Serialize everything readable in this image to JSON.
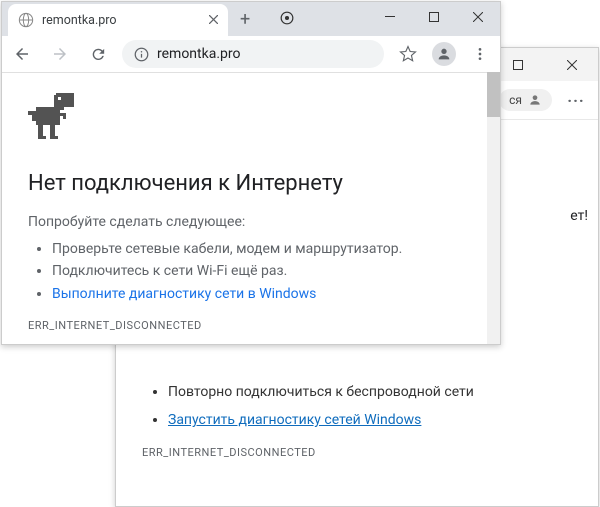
{
  "edge": {
    "toolbar": {
      "profile_fragment": "ся"
    },
    "content": {
      "list_item_1": "Повторно подключиться к беспроводной сети",
      "list_item_2": "Запустить диагностику сетей Windows",
      "error_code": "ERR_INTERNET_DISCONNECTED",
      "greeting_fragment": "ет!"
    }
  },
  "chrome": {
    "tab": {
      "title": "remontka.pro"
    },
    "omnibox": {
      "url": "remontka.pro"
    },
    "error": {
      "title": "Нет подключения к Интернету",
      "subtitle": "Попробуйте сделать следующее:",
      "item1": "Проверьте сетевые кабели, модем и маршрутизатор.",
      "item2": "Подключитесь к сети Wi-Fi ещё раз.",
      "item3": "Выполните диагностику сети в Windows",
      "code": "ERR_INTERNET_DISCONNECTED"
    }
  }
}
